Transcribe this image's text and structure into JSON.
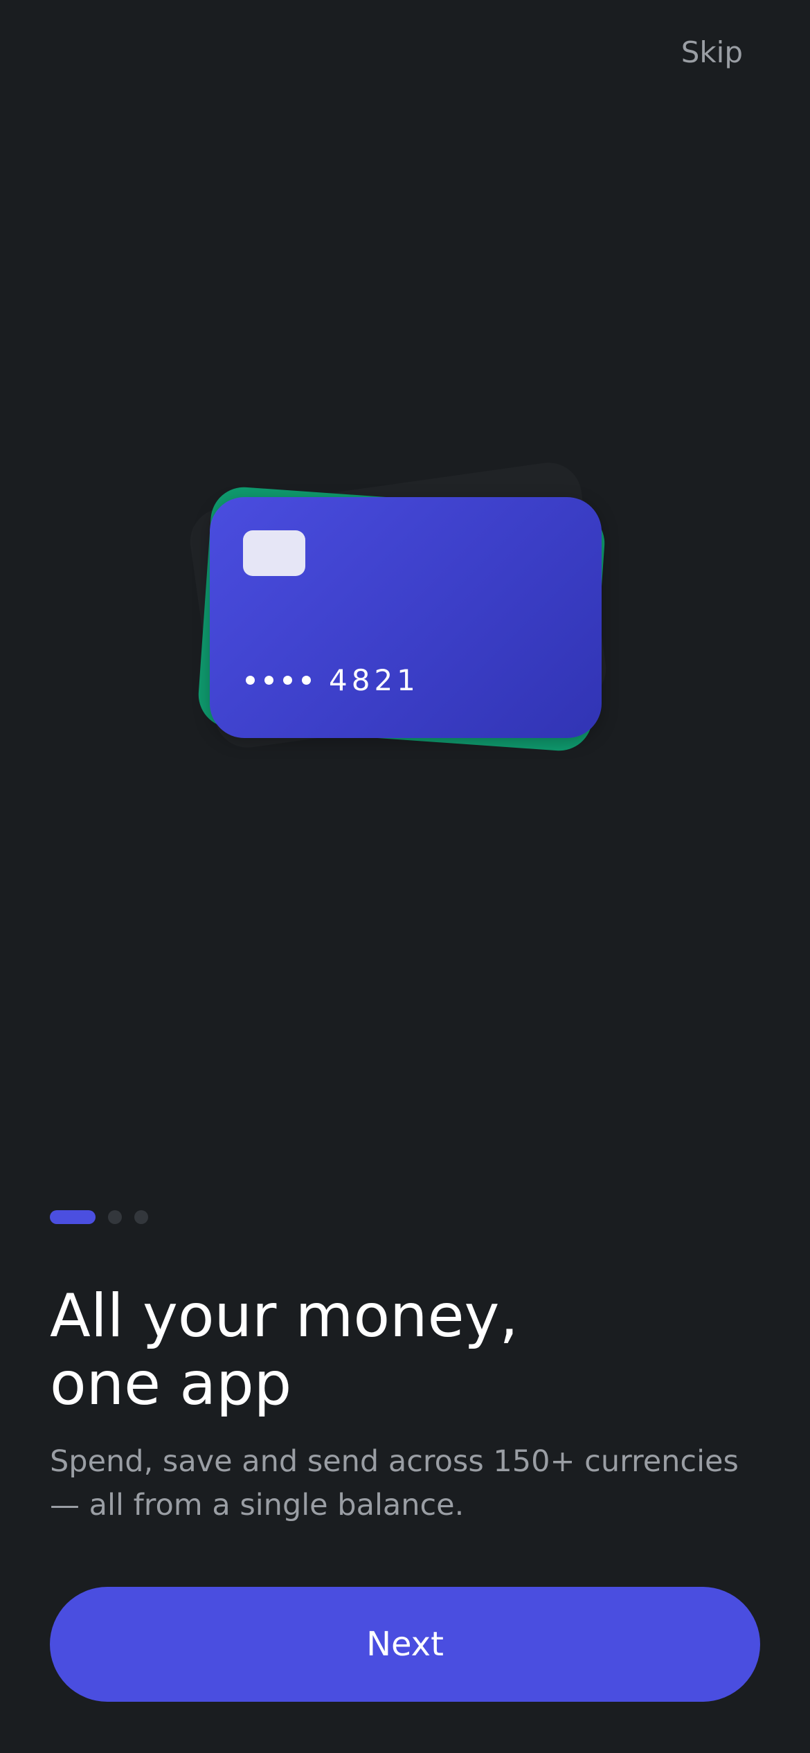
{
  "header": {
    "skip_label": "Skip"
  },
  "card": {
    "masked_dots": 4,
    "last_four": "4821"
  },
  "pager": {
    "total_pages": 3,
    "current_page": 1
  },
  "content": {
    "headline_line1": "All your money,",
    "headline_line2": "one app",
    "subtext_line1": "Spend, save and send across 150+ currencies",
    "subtext_line2": "— all from a single balance."
  },
  "actions": {
    "next_label": "Next"
  },
  "colors": {
    "background": "#1a1d20",
    "accent": "#4a4ee0",
    "card_back": "#0f9a6e",
    "muted_text": "#9a9ea4"
  }
}
